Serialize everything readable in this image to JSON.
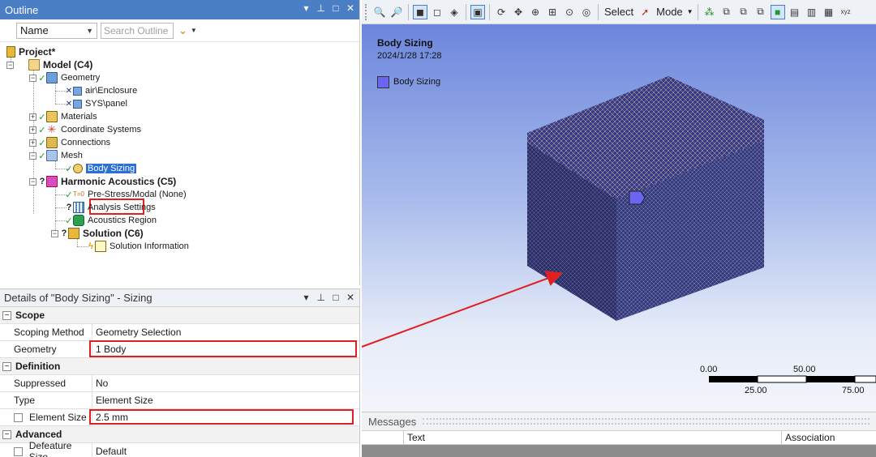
{
  "outline": {
    "title": "Outline",
    "controls": [
      "▾",
      "⊥",
      "□",
      "✕"
    ],
    "filter_combo": "Name",
    "search_placeholder": "Search Outline",
    "tree": [
      {
        "label": "Project*",
        "status": ""
      },
      {
        "label": "Model (C4)",
        "status": ""
      },
      {
        "label": "Geometry",
        "status": "✓"
      },
      {
        "label": "air\\Enclosure",
        "status": "✕"
      },
      {
        "label": "SYS\\panel",
        "status": "✕"
      },
      {
        "label": "Materials",
        "status": "✓"
      },
      {
        "label": "Coordinate Systems",
        "status": "✓"
      },
      {
        "label": "Connections",
        "status": "✓"
      },
      {
        "label": "Mesh",
        "status": "✓"
      },
      {
        "label": "Body Sizing",
        "status": "✓"
      },
      {
        "label": "Harmonic Acoustics (C5)",
        "status": "?"
      },
      {
        "label": "Pre-Stress/Modal (None)",
        "status": "✓"
      },
      {
        "label": "Analysis Settings",
        "status": "?"
      },
      {
        "label": "Acoustics Region",
        "status": "✓"
      },
      {
        "label": "Solution (C6)",
        "status": "?"
      },
      {
        "label": "Solution Information",
        "status": "ϟ"
      }
    ]
  },
  "details": {
    "title": "Details of \"Body Sizing\" - Sizing",
    "controls": [
      "▾",
      "⊥",
      "□",
      "✕"
    ],
    "sections": {
      "scope": "Scope",
      "definition": "Definition",
      "advanced": "Advanced"
    },
    "rows": {
      "scoping_method": {
        "label": "Scoping Method",
        "value": "Geometry Selection"
      },
      "geometry": {
        "label": "Geometry",
        "value": "1 Body"
      },
      "suppressed": {
        "label": "Suppressed",
        "value": "No"
      },
      "type": {
        "label": "Type",
        "value": "Element Size"
      },
      "element_size": {
        "label": "Element Size",
        "value": "2.5 mm"
      },
      "defeature_size": {
        "label": "Defeature Size",
        "value": "Default"
      }
    }
  },
  "toolbar": {
    "select_label": "Select",
    "mode_label": "Mode"
  },
  "viewport": {
    "title": "Body Sizing",
    "date": "2024/1/28 17:28",
    "legend_label": "Body Sizing",
    "legend_color": "#6a66f2",
    "scale_top": [
      "0.00",
      "50.00"
    ],
    "scale_bottom": [
      "25.00",
      "75.00"
    ]
  },
  "messages": {
    "title": "Messages",
    "columns": [
      "Text",
      "Association"
    ]
  }
}
